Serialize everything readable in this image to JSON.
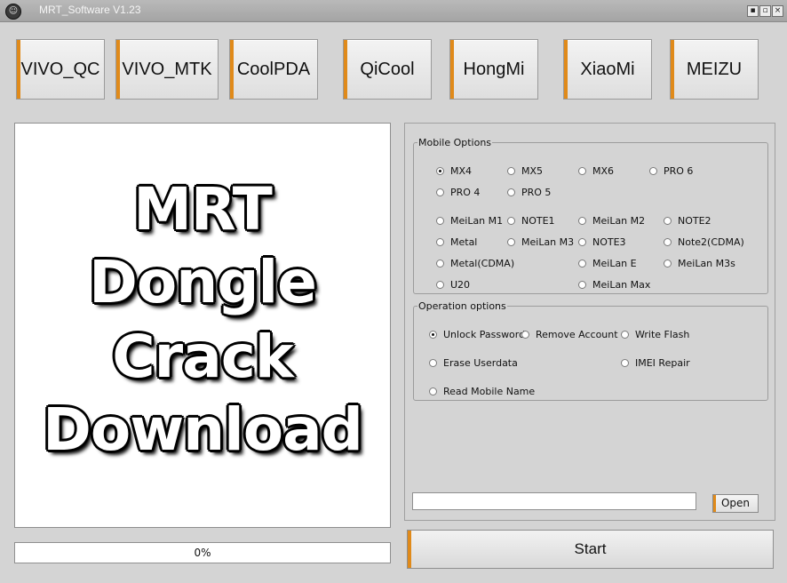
{
  "window": {
    "title": "MRT_Software V1.23",
    "icon": "app-icon"
  },
  "title_buttons": {
    "minimize": "▪",
    "maximize": "▫",
    "close": "×"
  },
  "vendor_tabs": [
    "VIVO_QC",
    "VIVO_MTK",
    "CoolPDA",
    "QiCool",
    "HongMi",
    "XiaoMi",
    "MEIZU"
  ],
  "accent_color": "#e08a1a",
  "banner": {
    "lines": [
      "MRT",
      "Dongle",
      "Crack",
      "Download"
    ]
  },
  "progress": {
    "text": "0%",
    "value": 0
  },
  "mobile_options": {
    "legend": "Mobile Options",
    "selected": "MX4",
    "items": [
      "MX4",
      "MX5",
      "MX6",
      "PRO 6",
      "PRO 4",
      "PRO 5",
      "MeiLan M1",
      "NOTE1",
      "MeiLan M2",
      "NOTE2",
      "Metal",
      "MeiLan M3",
      "NOTE3",
      "Note2(CDMA)",
      "Metal(CDMA)",
      "MeiLan E",
      "MeiLan M3s",
      "U20",
      "MeiLan Max"
    ]
  },
  "operation_options": {
    "legend": "Operation options",
    "selected": "Unlock Password",
    "items": [
      "Unlock Password",
      "Remove Account",
      "Write Flash",
      "Erase Userdata",
      "IMEI Repair",
      "Read Mobile Name"
    ]
  },
  "file": {
    "path_value": "",
    "open_label": "Open"
  },
  "start_label": "Start"
}
